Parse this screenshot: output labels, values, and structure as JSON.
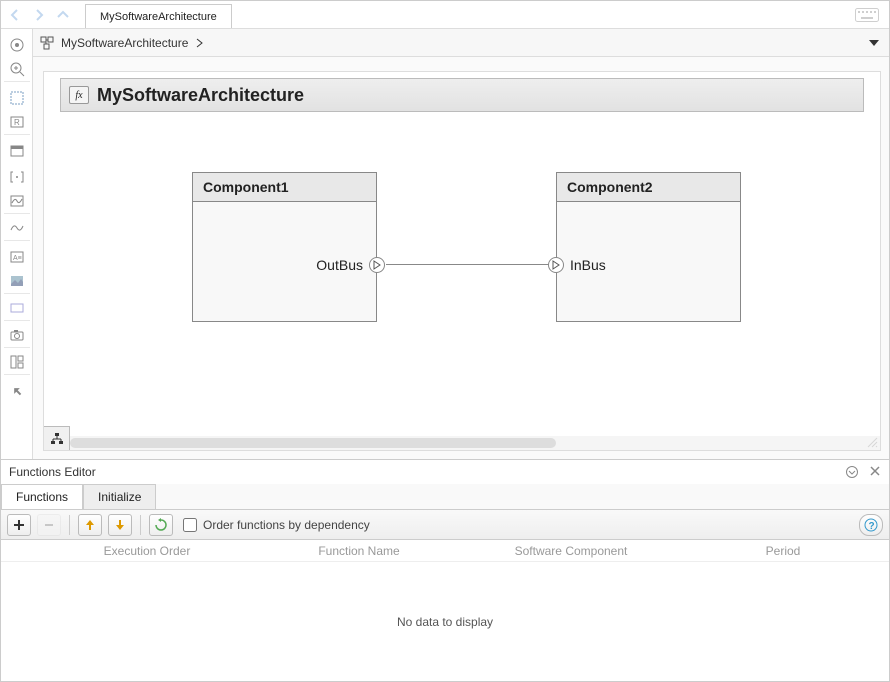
{
  "tab": {
    "label": "MySoftwareArchitecture"
  },
  "breadcrumb": {
    "label": "MySoftwareArchitecture"
  },
  "canvas": {
    "title": "MySoftwareArchitecture",
    "components": [
      {
        "name": "Component1",
        "out_port": "OutBus"
      },
      {
        "name": "Component2",
        "in_port": "InBus"
      }
    ]
  },
  "functions_panel": {
    "title": "Functions Editor",
    "tabs": [
      "Functions",
      "Initialize"
    ],
    "order_by_dependency_label": "Order functions by dependency",
    "columns": [
      "Execution Order",
      "Function Name",
      "Software Component",
      "Period"
    ],
    "empty_msg": "No data to display"
  }
}
